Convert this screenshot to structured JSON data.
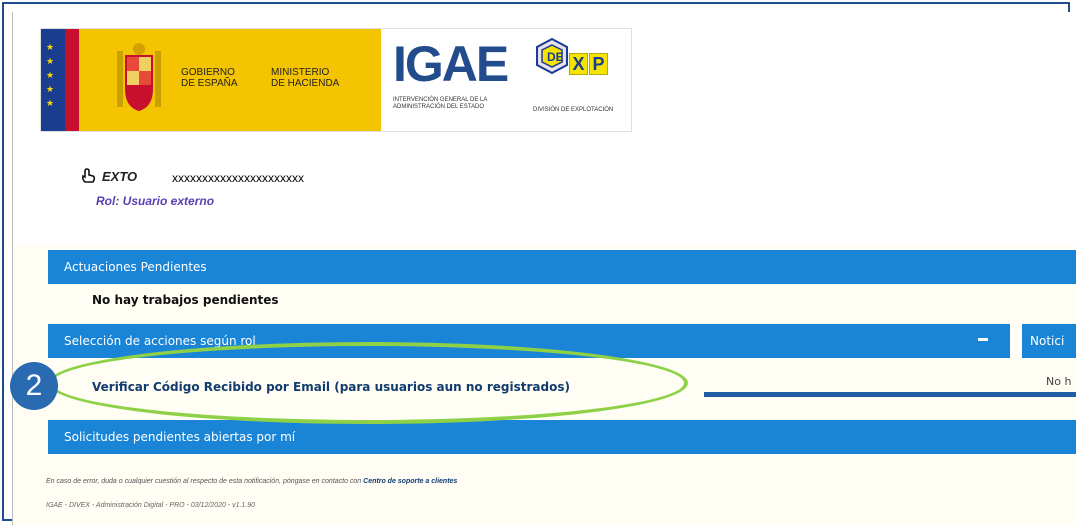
{
  "logos": {
    "gobierno_text": "GOBIERNO\nDE ESPAÑA",
    "ministerio_text": "MINISTERIO\nDE HACIENDA",
    "igae_title": "IGAE",
    "igae_subtitle": "INTERVENCIÓN GENERAL DE LA ADMINISTRACIÓN DEL ESTADO",
    "dexp_letters": [
      "X",
      "P"
    ],
    "dexp_subtitle": "DIVISIÓN DE EXPLOTACIÓN"
  },
  "user": {
    "prefix": "EXTO",
    "name": "xxxxxxxxxxxxxxxxxxxxxx",
    "role": "Rol: Usuario externo"
  },
  "panels": {
    "actuaciones_header": "Actuaciones Pendientes",
    "actuaciones_body": "No hay trabajos pendientes",
    "seleccion_header": "Selección de acciones según rol",
    "seleccion_link": "Verificar Código Recibido por Email (para usuarios aun no registrados)",
    "noticias_header": "Notici",
    "noticias_body": "No h",
    "solicitudes_header": "Solicitudes pendientes abiertas por mí"
  },
  "annotation": {
    "badge_number": "2"
  },
  "footer": {
    "help_text": "En caso de error, duda o cualquier cuestión al respecto de esta notificación, póngase en contacto con",
    "help_link": "Centro de soporte a clientes",
    "version_line": "IGAE - DIVEX - Administración Digital - PRO - 03/12/2020 - v1.1.90"
  },
  "colors": {
    "header_blue": "#1a85d6",
    "highlight_green": "#8ed046",
    "badge_blue": "#2a6ab1",
    "connector_blue": "#1d5ea5"
  }
}
